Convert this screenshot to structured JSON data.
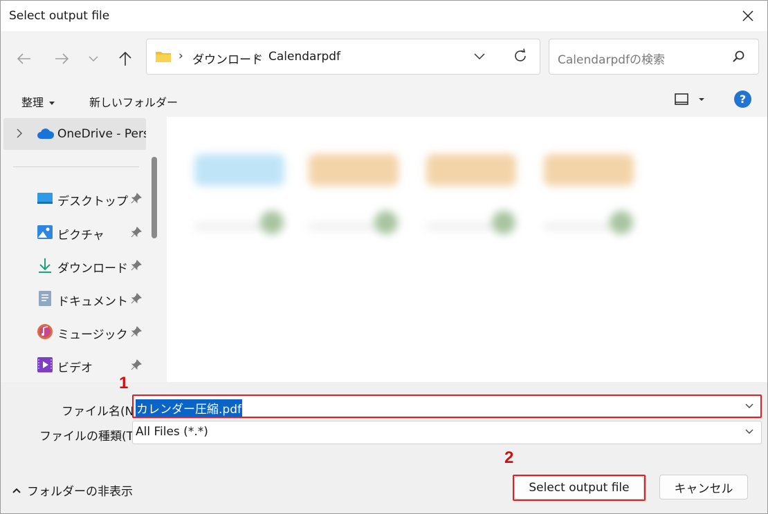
{
  "window": {
    "title": "Select output file"
  },
  "address": {
    "crumbs": [
      "ダウンロード",
      "Calendarpdf"
    ]
  },
  "search": {
    "placeholder": "Calendarpdfの検索"
  },
  "commands": {
    "organize": "整理",
    "new_folder": "新しいフォルダー"
  },
  "sidebar": {
    "onedrive": "OneDrive - Perso",
    "items": [
      {
        "label": "デスクトップ",
        "icon": "desktop-icon"
      },
      {
        "label": "ピクチャ",
        "icon": "pictures-icon"
      },
      {
        "label": "ダウンロード",
        "icon": "download-icon"
      },
      {
        "label": "ドキュメント",
        "icon": "documents-icon"
      },
      {
        "label": "ミュージック",
        "icon": "music-icon"
      },
      {
        "label": "ビデオ",
        "icon": "video-icon"
      }
    ]
  },
  "form": {
    "filename_label": "ファイル名(N):",
    "filename_value": "カレンダー圧縮.pdf",
    "filetype_label": "ファイルの種類(T):",
    "filetype_value": "All Files (*.*)"
  },
  "footer": {
    "hide_folders": "フォルダーの非表示",
    "primary_button": "Select output file",
    "cancel_button": "キャンセル"
  },
  "annotations": {
    "step1": "1",
    "step2": "2"
  },
  "colors": {
    "accent": "#0a64c8",
    "annotation": "#e02020"
  }
}
